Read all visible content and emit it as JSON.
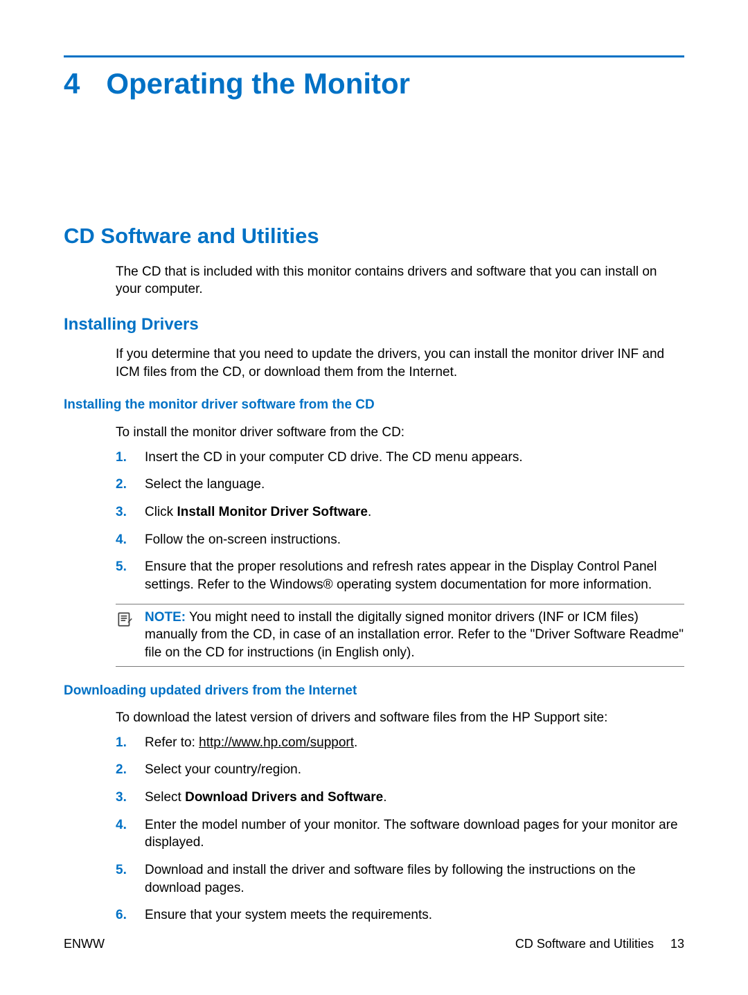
{
  "chapter": {
    "number": "4",
    "title": "Operating the Monitor"
  },
  "section": {
    "title": "CD Software and Utilities",
    "intro": "The CD that is included with this monitor contains drivers and software that you can install on your computer."
  },
  "sub1": {
    "title": "Installing Drivers",
    "intro": "If you determine that you need to update the drivers, you can install the monitor driver INF and ICM files from the CD, or download them from the Internet."
  },
  "sub1a": {
    "title": "Installing the monitor driver software from the CD",
    "intro": "To install the monitor driver software from the CD:",
    "steps": [
      {
        "n": "1.",
        "t": "Insert the CD in your computer CD drive. The CD menu appears."
      },
      {
        "n": "2.",
        "t": "Select the language."
      },
      {
        "n": "3.",
        "pre": "Click ",
        "bold": "Install Monitor Driver Software",
        "post": "."
      },
      {
        "n": "4.",
        "t": "Follow the on-screen instructions."
      },
      {
        "n": "5.",
        "t": "Ensure that the proper resolutions and refresh rates appear in the Display Control Panel settings. Refer to the Windows® operating system documentation for more information."
      }
    ],
    "note": {
      "label": "NOTE:",
      "text": "   You might need to install the digitally signed monitor drivers (INF or ICM files) manually from the CD, in case of an installation error. Refer to the \"Driver Software Readme\" file on the CD for instructions (in English only)."
    }
  },
  "sub1b": {
    "title": "Downloading updated drivers from the Internet",
    "intro": "To download the latest version of drivers and software files from the HP Support site:",
    "steps": [
      {
        "n": "1.",
        "pre": "Refer to: ",
        "link": "http://www.hp.com/support",
        "post": "."
      },
      {
        "n": "2.",
        "t": "Select your country/region."
      },
      {
        "n": "3.",
        "pre": "Select ",
        "bold": "Download Drivers and Software",
        "post": "."
      },
      {
        "n": "4.",
        "t": "Enter the model number of your monitor. The software download pages for your monitor are displayed."
      },
      {
        "n": "5.",
        "t": "Download and install the driver and software files by following the instructions on the download pages."
      },
      {
        "n": "6.",
        "t": "Ensure that your system meets the requirements."
      }
    ]
  },
  "footer": {
    "left": "ENWW",
    "rightLabel": "CD Software and Utilities",
    "page": "13"
  }
}
